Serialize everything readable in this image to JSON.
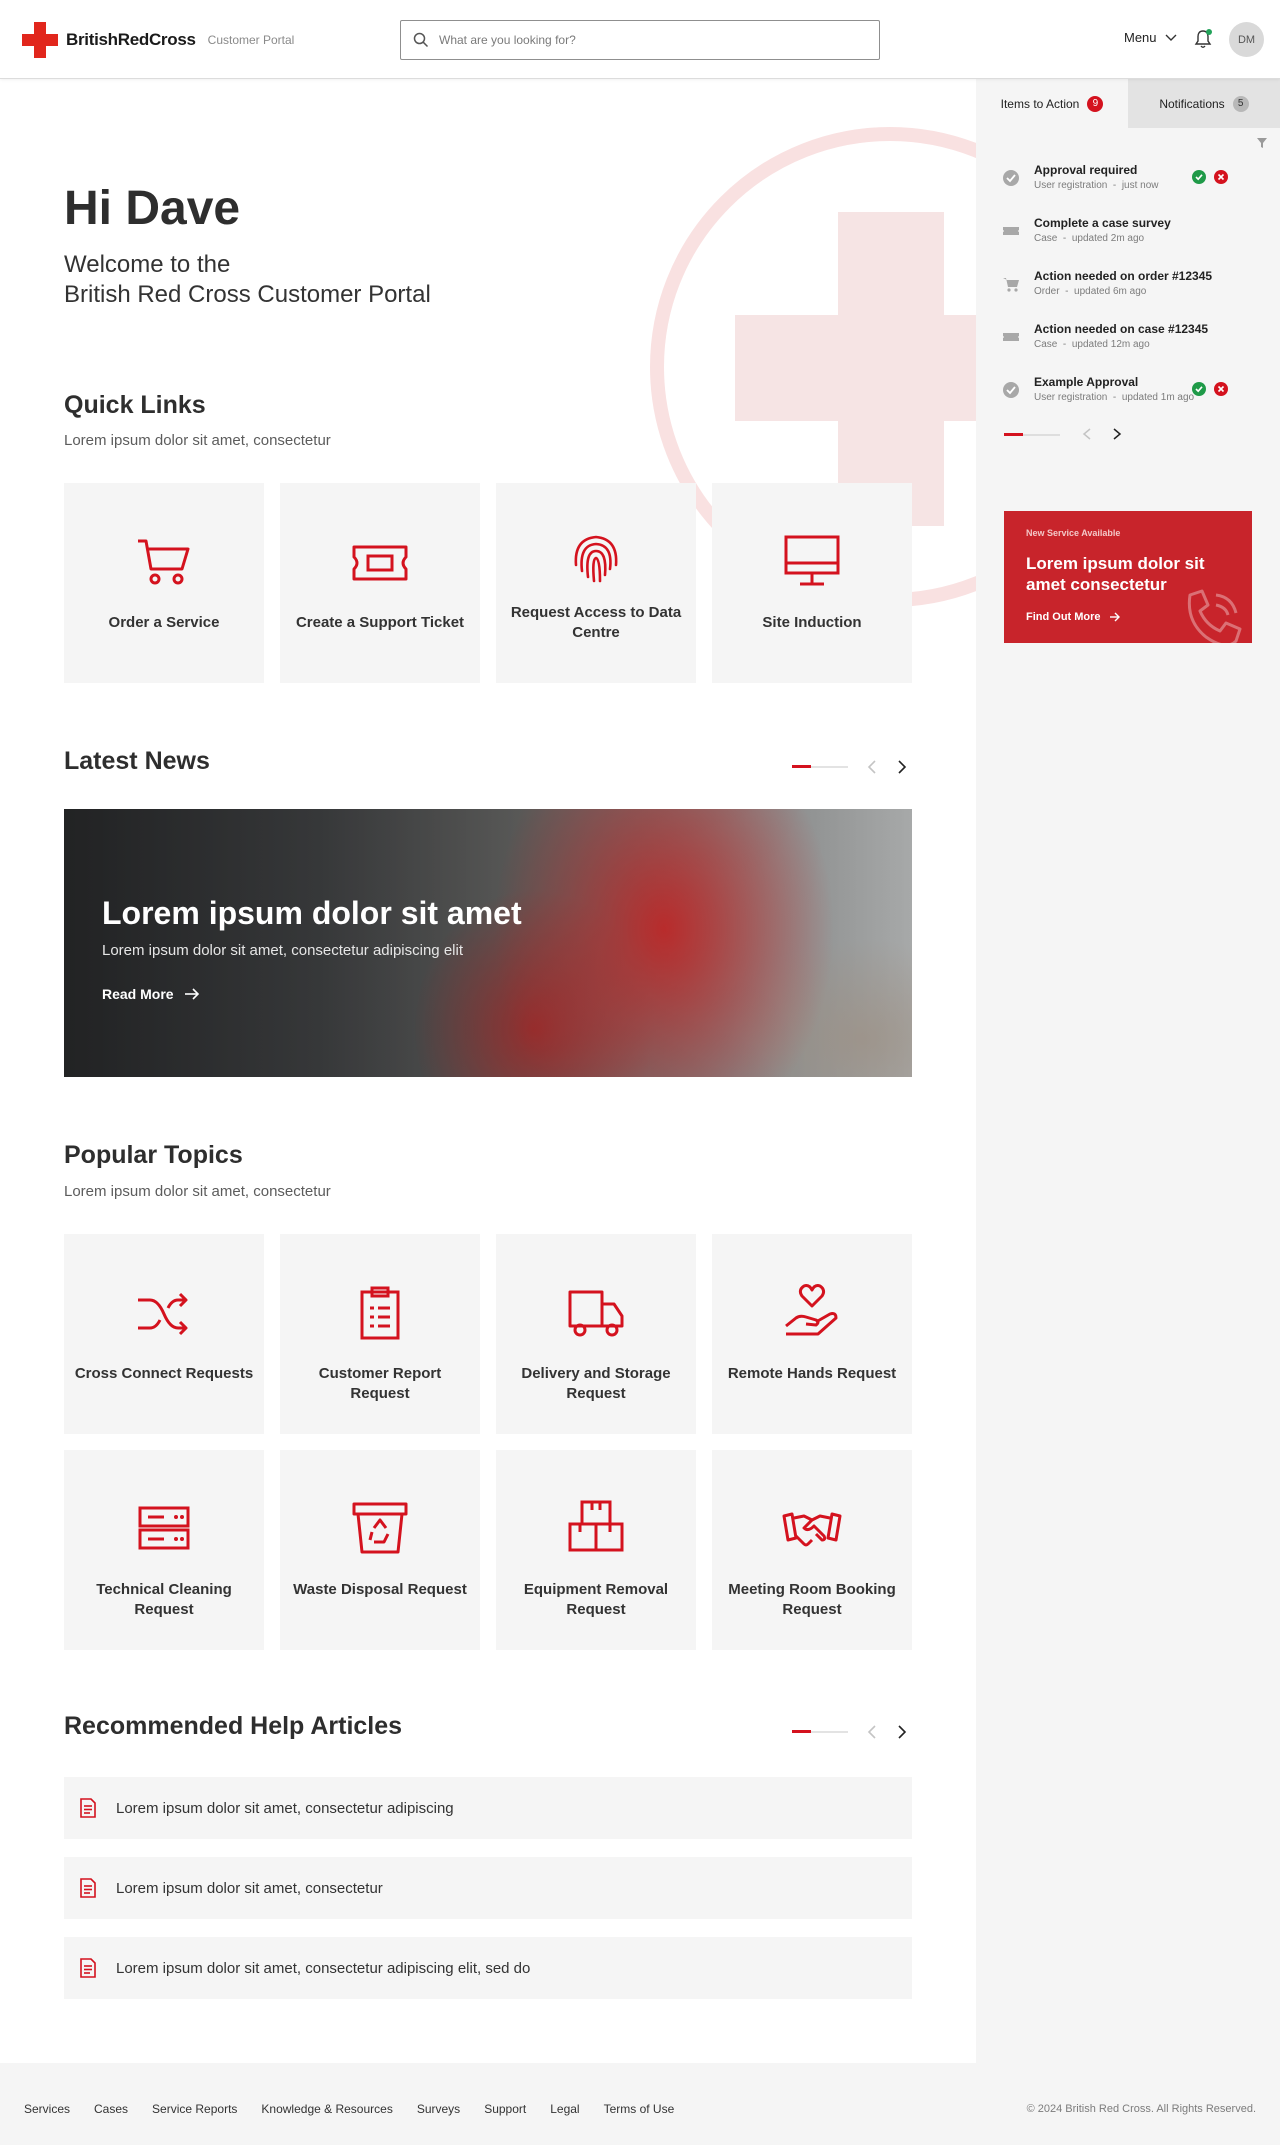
{
  "header": {
    "brand": "BritishRedCross",
    "portal_label": "Customer Portal",
    "search_placeholder": "What are you looking for?",
    "menu_label": "Menu",
    "avatar_initials": "DM"
  },
  "hero": {
    "greeting": "Hi Dave",
    "welcome_line1": "Welcome to the",
    "welcome_line2": "British Red Cross Customer Portal"
  },
  "quick_links": {
    "title": "Quick Links",
    "subtitle": "Lorem ipsum dolor sit amet, consectetur",
    "items": [
      {
        "label": "Order a Service",
        "icon": "cart-icon"
      },
      {
        "label": "Create a Support Ticket",
        "icon": "ticket-icon"
      },
      {
        "label": "Request Access to Data Centre",
        "icon": "fingerprint-icon"
      },
      {
        "label": "Site Induction",
        "icon": "monitor-icon"
      }
    ]
  },
  "latest_news": {
    "title": "Latest News",
    "headline": "Lorem ipsum dolor sit amet",
    "summary": "Lorem ipsum dolor sit amet, consectetur adipiscing elit",
    "link_label": "Read More"
  },
  "popular_topics": {
    "title": "Popular Topics",
    "subtitle": "Lorem ipsum dolor sit amet, consectetur",
    "items": [
      {
        "label": "Cross Connect Requests",
        "icon": "shuffle-icon"
      },
      {
        "label": "Customer Report Request",
        "icon": "clipboard-icon"
      },
      {
        "label": "Delivery and Storage Request",
        "icon": "truck-icon"
      },
      {
        "label": "Remote Hands Request",
        "icon": "hand-heart-icon"
      },
      {
        "label": "Technical Cleaning Request",
        "icon": "server-icon"
      },
      {
        "label": "Waste Disposal Request",
        "icon": "recycle-bin-icon"
      },
      {
        "label": "Equipment Removal Request",
        "icon": "boxes-icon"
      },
      {
        "label": "Meeting Room Booking Request",
        "icon": "handshake-icon"
      }
    ]
  },
  "help_articles": {
    "title": "Recommended Help Articles",
    "items": [
      {
        "label": "Lorem ipsum dolor sit amet, consectetur adipiscing"
      },
      {
        "label": "Lorem ipsum dolor sit amet, consectetur"
      },
      {
        "label": "Lorem ipsum dolor sit amet, consectetur adipiscing elit, sed do"
      }
    ]
  },
  "panel": {
    "tab_actions": "Items to Action",
    "tab_actions_count": "9",
    "tab_notifications": "Notifications",
    "tab_notifications_count": "5",
    "items": [
      {
        "title": "Approval required",
        "type": "User registration",
        "time": "just now",
        "icon": "check-circle-icon",
        "approval": true
      },
      {
        "title": "Complete a case survey",
        "type": "Case",
        "time": "updated 2m ago",
        "icon": "ticket-icon",
        "approval": false
      },
      {
        "title": "Action needed on order #12345",
        "type": "Order",
        "time": "updated 6m ago",
        "icon": "cart-icon",
        "approval": false
      },
      {
        "title": "Action needed on case #12345",
        "type": "Case",
        "time": "updated 12m ago",
        "icon": "ticket-icon",
        "approval": false
      },
      {
        "title": "Example Approval",
        "type": "User registration",
        "time": "updated 1m ago",
        "icon": "check-circle-icon",
        "approval": true
      }
    ],
    "meta_separator": "-",
    "promo": {
      "tag": "New Service Available",
      "title": "Lorem ipsum dolor sit amet consectetur",
      "link_label": "Find Out More"
    }
  },
  "footer": {
    "links": [
      "Services",
      "Cases",
      "Service Reports",
      "Knowledge & Resources",
      "Surveys",
      "Support",
      "Legal",
      "Terms of Use"
    ],
    "copyright": "© 2024 British Red Cross. All Rights Reserved."
  },
  "colors": {
    "brand_red": "#e1261c",
    "accent_red": "#d4121e",
    "approve_green": "#1f9a48",
    "tile_bg": "#f5f5f5"
  }
}
